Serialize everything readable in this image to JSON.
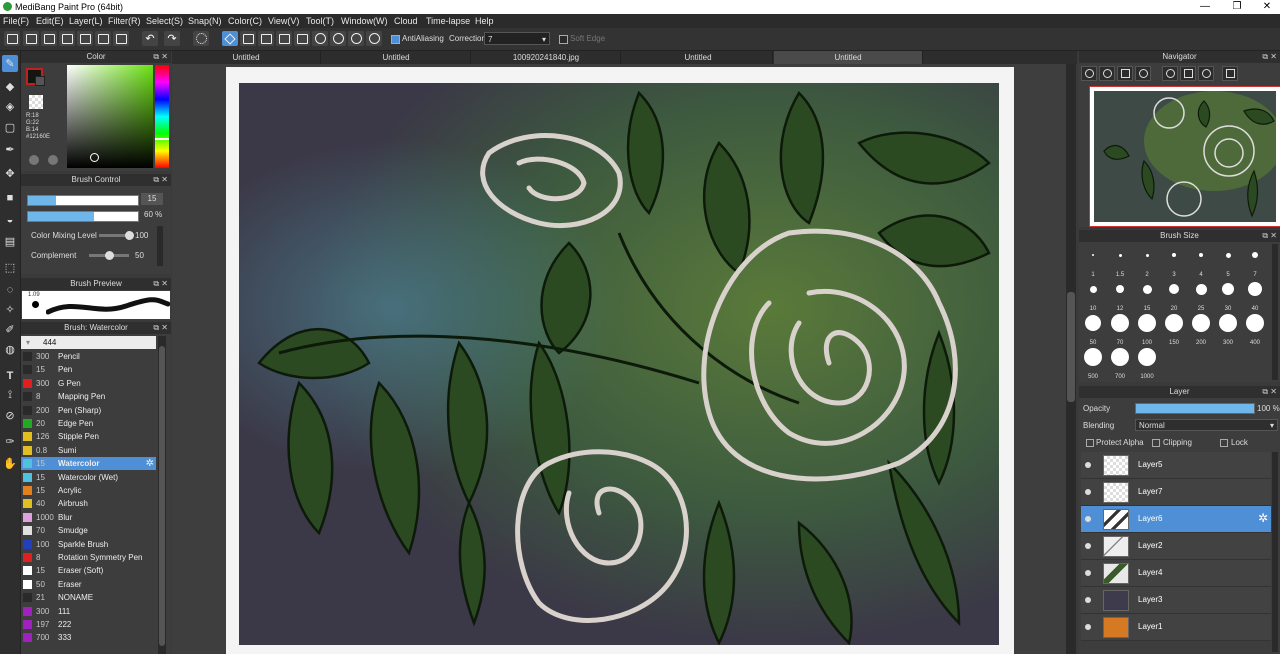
{
  "window": {
    "title": "MediBang Paint Pro (64bit)",
    "controls": [
      "—",
      "❐",
      "✕"
    ]
  },
  "menu": [
    "File(F)",
    "Edit(E)",
    "Layer(L)",
    "Filter(R)",
    "Select(S)",
    "Snap(N)",
    "Color(C)",
    "View(V)",
    "Tool(T)",
    "Window(W)",
    "Cloud",
    "Time-lapse",
    "Help"
  ],
  "toolbar": {
    "antialiasing_label": "AntiAliasing",
    "correction_label": "Correction",
    "correction_value": "7",
    "soft_edge_label": "Soft Edge"
  },
  "color_panel": {
    "title": "Color",
    "rgb": [
      "R:18",
      "G:22",
      "B:14"
    ],
    "hex": "#12160E",
    "primary": "#12160e",
    "accent": "#aa2020"
  },
  "brush_control": {
    "title": "Brush Control",
    "size_value": "15",
    "size_fraction": 0.25,
    "opacity_value": "60 %",
    "opacity_fraction": 0.6,
    "mixing_label": "Color Mixing Level",
    "mixing_value": "100",
    "mixing_fraction": 1.0,
    "complement_label": "Complement",
    "complement_value": "50",
    "complement_fraction": 0.5
  },
  "brush_preview": {
    "title": "Brush Preview",
    "size_label": "1.09"
  },
  "brush_list": {
    "title": "Brush: Watercolor",
    "header_value": "444",
    "items": [
      {
        "size": "300",
        "name": "Pencil",
        "color": "#2a2a2a"
      },
      {
        "size": "15",
        "name": "Pen",
        "color": "#2a2a2a"
      },
      {
        "size": "300",
        "name": "G Pen",
        "color": "#e02020"
      },
      {
        "size": "8",
        "name": "Mapping Pen",
        "color": "#2a2a2a"
      },
      {
        "size": "200",
        "name": "Pen (Sharp)",
        "color": "#2a2a2a"
      },
      {
        "size": "20",
        "name": "Edge Pen",
        "color": "#22aa22"
      },
      {
        "size": "126",
        "name": "Stipple Pen",
        "color": "#e0c020"
      },
      {
        "size": "0.8",
        "name": "Sumi",
        "color": "#e0c020"
      },
      {
        "size": "15",
        "name": "Watercolor",
        "color": "#4fc0e0",
        "selected": true
      },
      {
        "size": "15",
        "name": "Watercolor (Wet)",
        "color": "#4fc0e0"
      },
      {
        "size": "15",
        "name": "Acrylic",
        "color": "#e08020"
      },
      {
        "size": "40",
        "name": "Airbrush",
        "color": "#e0c020"
      },
      {
        "size": "1000",
        "name": "Blur",
        "color": "#e0a0e0"
      },
      {
        "size": "70",
        "name": "Smudge",
        "color": "#e0e0e0"
      },
      {
        "size": "100",
        "name": "Sparkle Brush",
        "color": "#2040c0"
      },
      {
        "size": "8",
        "name": "Rotation Symmetry Pen",
        "color": "#e02020"
      },
      {
        "size": "15",
        "name": "Eraser (Soft)",
        "color": "#ffffff"
      },
      {
        "size": "50",
        "name": "Eraser",
        "color": "#ffffff"
      },
      {
        "size": "21",
        "name": "NONAME",
        "color": "#2a2a2a"
      },
      {
        "size": "300",
        "name": "111",
        "color": "#a020c0"
      },
      {
        "size": "197",
        "name": "222",
        "color": "#a020c0"
      },
      {
        "size": "700",
        "name": "333",
        "color": "#a020c0"
      }
    ]
  },
  "tabs": [
    {
      "label": "Untitled"
    },
    {
      "label": "Untitled"
    },
    {
      "label": "100920241840.jpg"
    },
    {
      "label": "Untitled"
    },
    {
      "label": "Untitled",
      "active": true
    }
  ],
  "navigator": {
    "title": "Navigator"
  },
  "brush_size": {
    "title": "Brush Size",
    "sizes": [
      "1",
      "1.5",
      "2",
      "3",
      "4",
      "5",
      "7",
      "10",
      "12",
      "15",
      "20",
      "25",
      "30",
      "40",
      "50",
      "70",
      "100",
      "150",
      "200",
      "300",
      "400",
      "500",
      "700",
      "1000"
    ]
  },
  "layer_panel": {
    "title": "Layer",
    "opacity_label": "Opacity",
    "opacity_value": "100 %",
    "opacity_fraction": 1.0,
    "blending_label": "Blending",
    "blending_value": "Normal",
    "protect_alpha_label": "Protect Alpha",
    "clipping_label": "Clipping",
    "lock_label": "Lock",
    "layers": [
      {
        "name": "Layer5",
        "thumb": "transparent"
      },
      {
        "name": "Layer7",
        "thumb": "transparent"
      },
      {
        "name": "Layer6",
        "thumb": "lines",
        "selected": true
      },
      {
        "name": "Layer2",
        "thumb": "sketch"
      },
      {
        "name": "Layer4",
        "thumb": "leaves"
      },
      {
        "name": "Layer3",
        "thumb": "#3e3c4c"
      },
      {
        "name": "Layer1",
        "thumb": "#d57a22"
      }
    ]
  }
}
